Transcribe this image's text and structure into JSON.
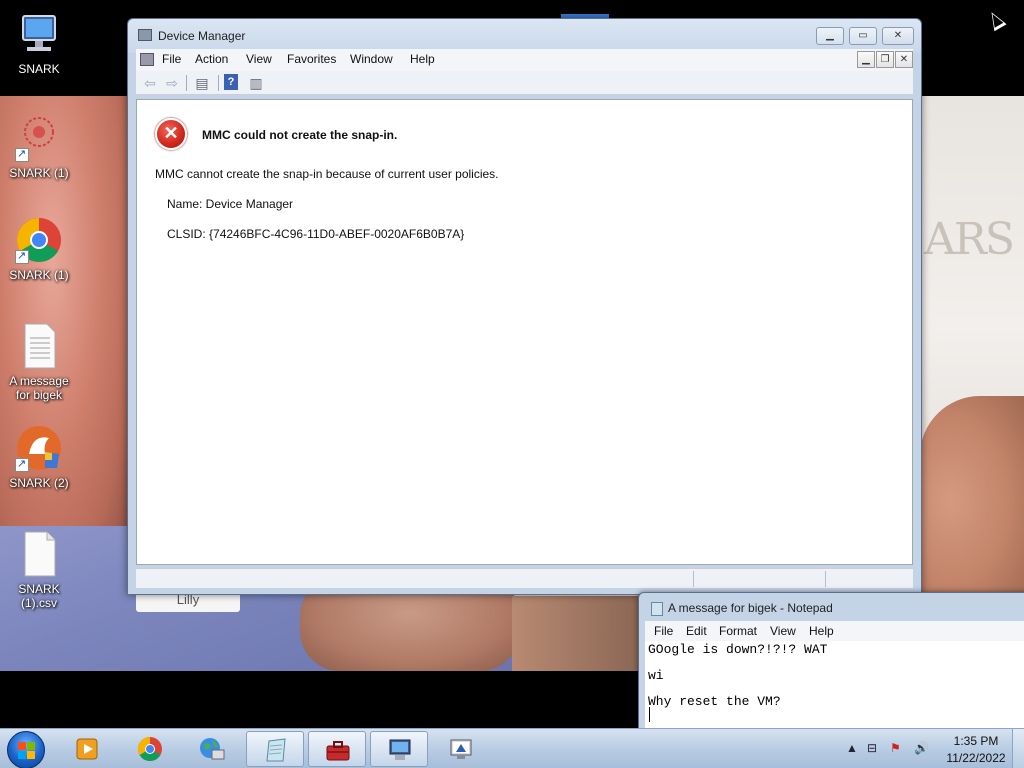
{
  "desktop": {
    "icons": [
      {
        "label": "SNARK",
        "icon": "computer-icon"
      },
      {
        "label": "SNARK (1)",
        "icon": "network-shortcut-icon"
      },
      {
        "label": "SNARK (1)",
        "icon": "chrome-icon"
      },
      {
        "label": "A message for bigek",
        "icon": "text-file-icon"
      },
      {
        "label": "SNARK (2)",
        "icon": "setup-icon"
      },
      {
        "label": "SNARK (1).csv",
        "icon": "blank-file-icon"
      }
    ],
    "wallpaper_badge": "Lilly",
    "wallpaper_text": "ARS"
  },
  "mmc": {
    "title": "Device Manager",
    "menu": [
      "File",
      "Action",
      "View",
      "Favorites",
      "Window",
      "Help"
    ],
    "error_title": "MMC could not create the snap-in.",
    "error_message": "MMC cannot create the snap-in because of current user policies.",
    "name_line": "Name: Device Manager",
    "clsid_line": "CLSID: {74246BFC-4C96-11D0-ABEF-0020AF6B0B7A}"
  },
  "notepad": {
    "title": "A message for bigek - Notepad",
    "menu": [
      "File",
      "Edit",
      "Format",
      "View",
      "Help"
    ],
    "lines": [
      "GOogle is down?!?!? WAT",
      "",
      "wi",
      "",
      "Why reset the VM?"
    ]
  },
  "taskbar": {
    "apps": [
      "media-player-icon",
      "chrome-icon",
      "network-globe-icon",
      "notepad-icon",
      "toolbox-icon",
      "computer-management-icon",
      "remote-desktop-icon"
    ],
    "time": "1:35 PM",
    "date": "11/22/2022"
  },
  "colors": {
    "accent": "#1a62c9",
    "error": "#d0261b"
  }
}
